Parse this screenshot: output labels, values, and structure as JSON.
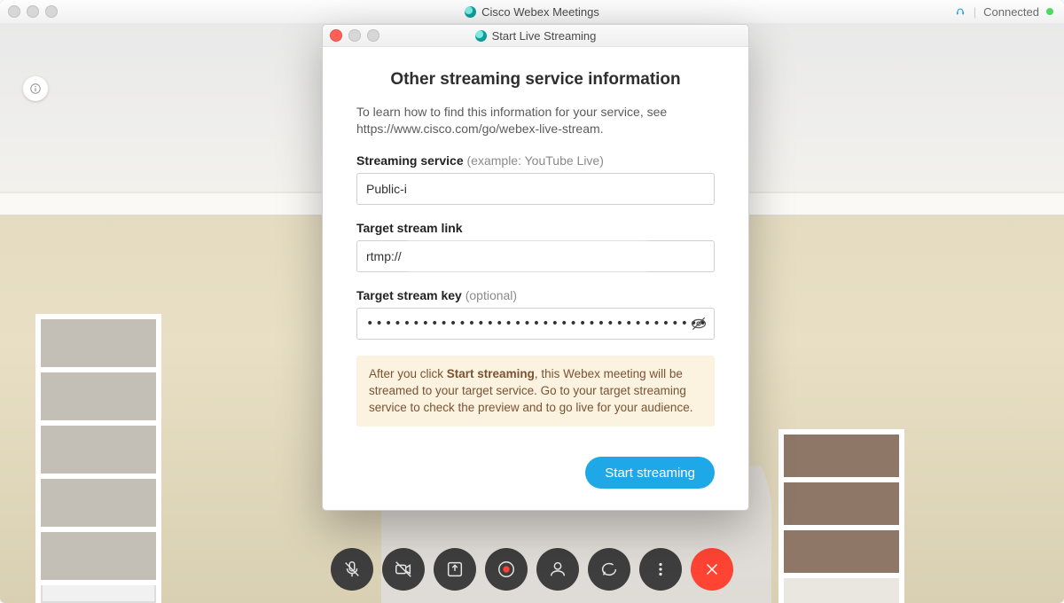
{
  "app": {
    "title": "Cisco Webex Meetings",
    "status_label": "Connected"
  },
  "info_badge": {
    "icon": "info"
  },
  "controls": {
    "mute": "mute-microphone",
    "video": "stop-video",
    "share": "share-content",
    "record": "record",
    "participants": "participants",
    "chat": "chat",
    "more": "more-options",
    "end": "end-call"
  },
  "dialog": {
    "window_title": "Start Live Streaming",
    "title": "Other streaming service information",
    "help_text": "To learn how to find this information for your service, see https://www.cisco.com/go/webex-live-stream.",
    "service_label": "Streaming service",
    "service_example": "(example: YouTube Live)",
    "service_value": "Public-i",
    "link_label": "Target stream link",
    "link_value": "rtmp://",
    "key_label": "Target stream key",
    "key_optional": "(optional)",
    "key_value": "••••••••••••••••••••••••••••••••••••••••••••••••",
    "note_prefix": "After you click ",
    "note_strong": "Start streaming",
    "note_suffix": ", this Webex meeting will be streamed to your target service. Go to your target streaming service to check the preview and to go live for your audience.",
    "start_button": "Start streaming"
  }
}
